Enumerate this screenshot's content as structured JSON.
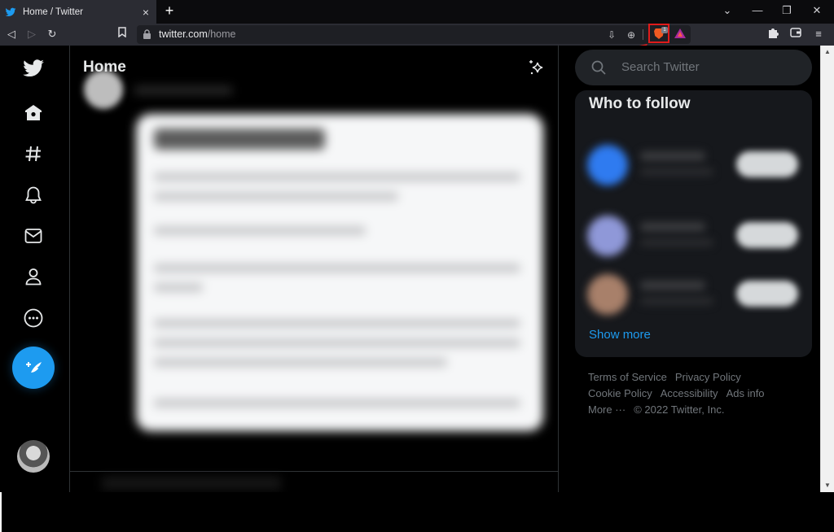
{
  "browser": {
    "tab": {
      "title": "Home / Twitter",
      "favicon": "twitter-bird-icon",
      "close_icon": "×"
    },
    "new_tab_icon": "+",
    "window_controls": {
      "tab_search": "⌄",
      "minimize": "—",
      "restore": "❐",
      "close": "✕"
    },
    "nav": {
      "back": "◁",
      "forward": "▷",
      "reload": "↻",
      "bookmark": "🔖"
    },
    "url": {
      "host": "twitter.com",
      "path": "/home"
    },
    "url_icons": {
      "install": "⇩",
      "zoom": "⊕"
    },
    "brave_shields": {
      "badge_count": "1",
      "highlight_color": "#e01b1b"
    },
    "extensions_icon": "puzzle-icon",
    "wallet_icon": "wallet-icon",
    "menu_icon": "≡"
  },
  "twitter": {
    "accent_color": "#1d9bf0",
    "nav_items": [
      {
        "name": "twitter-logo"
      },
      {
        "name": "home"
      },
      {
        "name": "explore"
      },
      {
        "name": "notifications"
      },
      {
        "name": "messages"
      },
      {
        "name": "profile"
      },
      {
        "name": "more"
      }
    ],
    "main": {
      "title": "Home"
    },
    "sidebar": {
      "search_placeholder": "Search Twitter",
      "who_to_follow": {
        "title": "Who to follow",
        "suggestions": [
          {
            "avatar_color": "#2f7bf0"
          },
          {
            "avatar_color": "#8f98d8"
          },
          {
            "avatar_color": "#a8806a"
          }
        ],
        "show_more": "Show more"
      },
      "footer_links": [
        "Terms of Service",
        "Privacy Policy",
        "Cookie Policy",
        "Accessibility",
        "Ads info",
        "More ···",
        "© 2022 Twitter, Inc."
      ]
    }
  },
  "scrollbar": {
    "up": "▲",
    "down": "▼"
  }
}
